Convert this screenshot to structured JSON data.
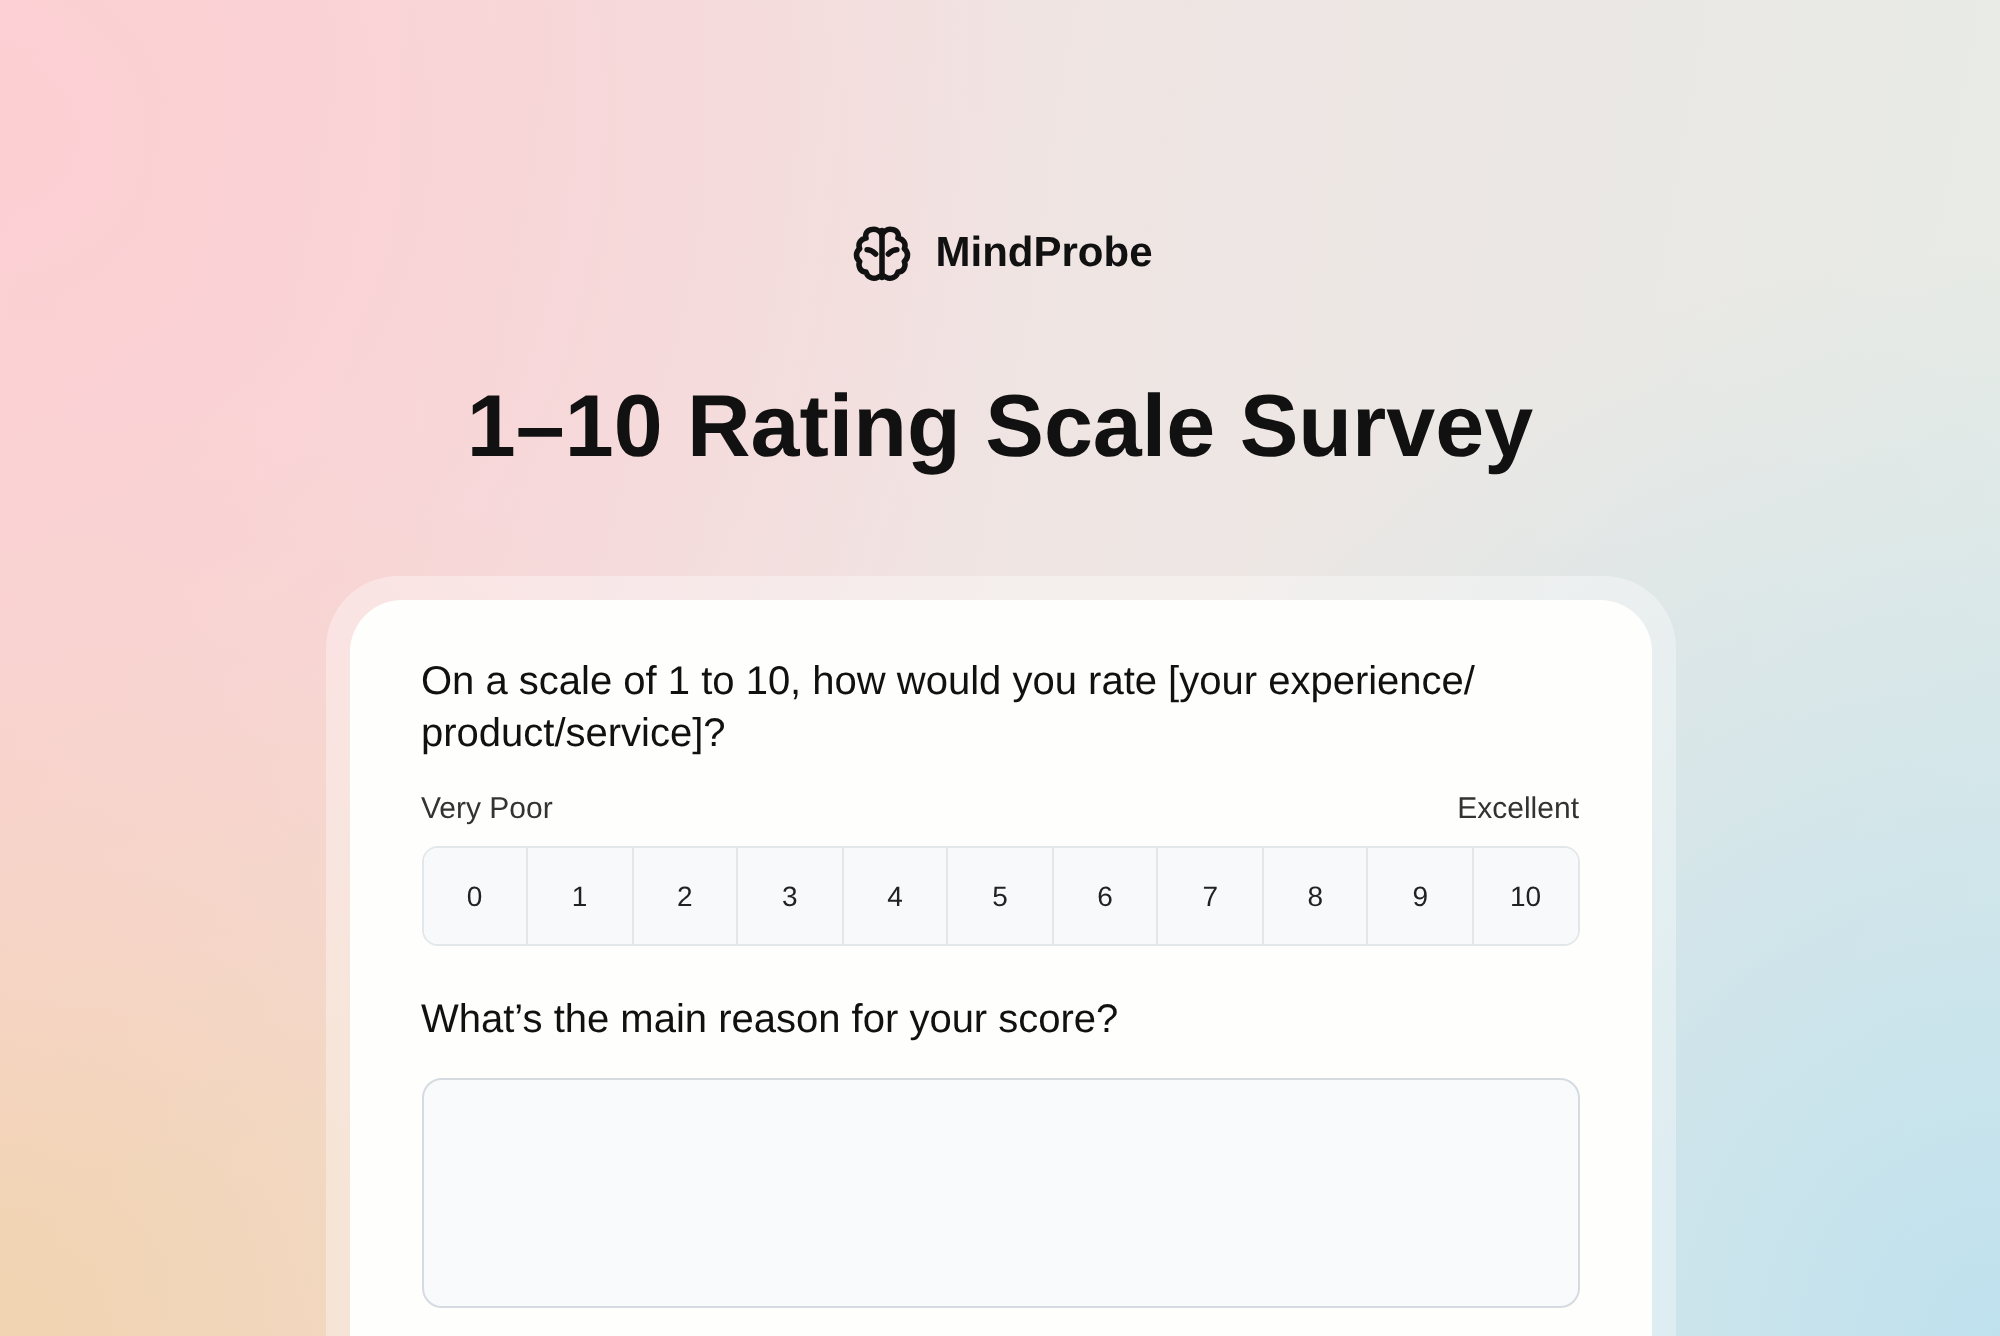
{
  "brand": {
    "name": "MindProbe"
  },
  "title": "1–10 Rating Scale Survey",
  "survey": {
    "question": "On a scale of 1 to 10, how would you rate [your experience/ product/service]?",
    "scale_labels": {
      "low": "Very Poor",
      "high": "Excellent"
    },
    "scale": [
      {
        "label": "0",
        "selected": false
      },
      {
        "label": "1",
        "selected": false
      },
      {
        "label": "2",
        "selected": false
      },
      {
        "label": "3",
        "selected": false
      },
      {
        "label": "4",
        "selected": false
      },
      {
        "label": "5",
        "selected": false
      },
      {
        "label": "6",
        "selected": false
      },
      {
        "label": "7",
        "selected": false
      },
      {
        "label": "8",
        "selected": false
      },
      {
        "label": "9",
        "selected": false
      },
      {
        "label": "10",
        "selected": false
      }
    ],
    "followup_question": "What’s the main reason for your score?"
  }
}
